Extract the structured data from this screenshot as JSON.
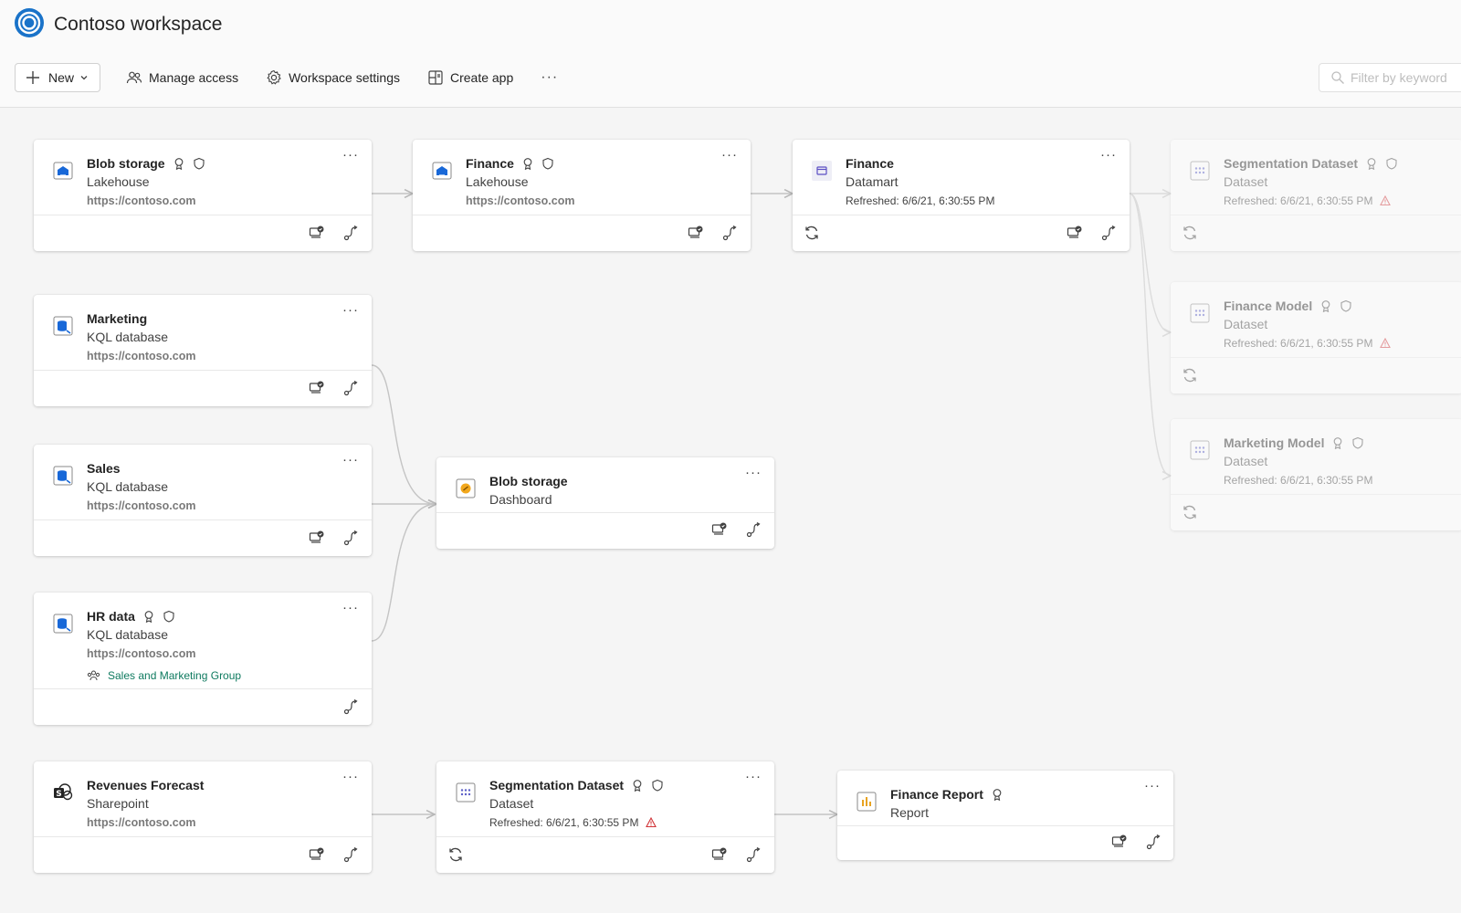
{
  "header": {
    "title": "Contoso workspace"
  },
  "toolbar": {
    "new_label": "New",
    "manage_access": "Manage access",
    "workspace_settings": "Workspace settings",
    "create_app": "Create app",
    "more": "···"
  },
  "filter": {
    "placeholder": "Filter by keyword"
  },
  "cards": {
    "blob_lakehouse": {
      "name": "Blob storage",
      "type": "Lakehouse",
      "url": "https://contoso.com"
    },
    "finance_lakehouse": {
      "name": "Finance",
      "type": "Lakehouse",
      "url": "https://contoso.com"
    },
    "finance_datamart": {
      "name": "Finance",
      "type": "Datamart",
      "refreshed": "Refreshed: 6/6/21, 6:30:55 PM"
    },
    "seg_dataset_right": {
      "name": "Segmentation Dataset",
      "type": "Dataset",
      "refreshed": "Refreshed: 6/6/21, 6:30:55 PM"
    },
    "finance_model": {
      "name": "Finance Model",
      "type": "Dataset",
      "refreshed": "Refreshed: 6/6/21, 6:30:55 PM"
    },
    "marketing_model": {
      "name": "Marketing Model",
      "type": "Dataset",
      "refreshed": "Refreshed: 6/6/21, 6:30:55 PM"
    },
    "marketing": {
      "name": "Marketing",
      "type": "KQL database",
      "url": "https://contoso.com"
    },
    "sales": {
      "name": "Sales",
      "type": "KQL database",
      "url": "https://contoso.com"
    },
    "blob_dashboard": {
      "name": "Blob storage",
      "type": "Dashboard"
    },
    "hr_data": {
      "name": "HR data",
      "type": "KQL database",
      "url": "https://contoso.com",
      "group": "Sales and Marketing Group"
    },
    "revenues": {
      "name": "Revenues Forecast",
      "type": "Sharepoint",
      "url": "https://contoso.com"
    },
    "seg_dataset": {
      "name": "Segmentation Dataset",
      "type": "Dataset",
      "refreshed": "Refreshed: 6/6/21, 6:30:55 PM"
    },
    "finance_report": {
      "name": "Finance Report",
      "type": "Report"
    }
  },
  "card_more": "···",
  "colors": {
    "accent": "#0f6cbd",
    "warning": "#d13438",
    "group_link": "#0e7a5f"
  }
}
